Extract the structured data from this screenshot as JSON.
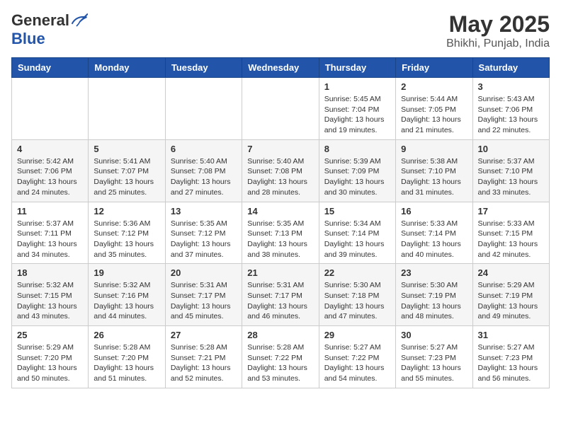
{
  "logo": {
    "general": "General",
    "blue": "Blue"
  },
  "title": "May 2025",
  "location": "Bhikhi, Punjab, India",
  "weekdays": [
    "Sunday",
    "Monday",
    "Tuesday",
    "Wednesday",
    "Thursday",
    "Friday",
    "Saturday"
  ],
  "weeks": [
    [
      {
        "day": "",
        "sunrise": "",
        "sunset": "",
        "daylight": ""
      },
      {
        "day": "",
        "sunrise": "",
        "sunset": "",
        "daylight": ""
      },
      {
        "day": "",
        "sunrise": "",
        "sunset": "",
        "daylight": ""
      },
      {
        "day": "",
        "sunrise": "",
        "sunset": "",
        "daylight": ""
      },
      {
        "day": "1",
        "sunrise": "Sunrise: 5:45 AM",
        "sunset": "Sunset: 7:04 PM",
        "daylight": "Daylight: 13 hours and 19 minutes."
      },
      {
        "day": "2",
        "sunrise": "Sunrise: 5:44 AM",
        "sunset": "Sunset: 7:05 PM",
        "daylight": "Daylight: 13 hours and 21 minutes."
      },
      {
        "day": "3",
        "sunrise": "Sunrise: 5:43 AM",
        "sunset": "Sunset: 7:06 PM",
        "daylight": "Daylight: 13 hours and 22 minutes."
      }
    ],
    [
      {
        "day": "4",
        "sunrise": "Sunrise: 5:42 AM",
        "sunset": "Sunset: 7:06 PM",
        "daylight": "Daylight: 13 hours and 24 minutes."
      },
      {
        "day": "5",
        "sunrise": "Sunrise: 5:41 AM",
        "sunset": "Sunset: 7:07 PM",
        "daylight": "Daylight: 13 hours and 25 minutes."
      },
      {
        "day": "6",
        "sunrise": "Sunrise: 5:40 AM",
        "sunset": "Sunset: 7:08 PM",
        "daylight": "Daylight: 13 hours and 27 minutes."
      },
      {
        "day": "7",
        "sunrise": "Sunrise: 5:40 AM",
        "sunset": "Sunset: 7:08 PM",
        "daylight": "Daylight: 13 hours and 28 minutes."
      },
      {
        "day": "8",
        "sunrise": "Sunrise: 5:39 AM",
        "sunset": "Sunset: 7:09 PM",
        "daylight": "Daylight: 13 hours and 30 minutes."
      },
      {
        "day": "9",
        "sunrise": "Sunrise: 5:38 AM",
        "sunset": "Sunset: 7:10 PM",
        "daylight": "Daylight: 13 hours and 31 minutes."
      },
      {
        "day": "10",
        "sunrise": "Sunrise: 5:37 AM",
        "sunset": "Sunset: 7:10 PM",
        "daylight": "Daylight: 13 hours and 33 minutes."
      }
    ],
    [
      {
        "day": "11",
        "sunrise": "Sunrise: 5:37 AM",
        "sunset": "Sunset: 7:11 PM",
        "daylight": "Daylight: 13 hours and 34 minutes."
      },
      {
        "day": "12",
        "sunrise": "Sunrise: 5:36 AM",
        "sunset": "Sunset: 7:12 PM",
        "daylight": "Daylight: 13 hours and 35 minutes."
      },
      {
        "day": "13",
        "sunrise": "Sunrise: 5:35 AM",
        "sunset": "Sunset: 7:12 PM",
        "daylight": "Daylight: 13 hours and 37 minutes."
      },
      {
        "day": "14",
        "sunrise": "Sunrise: 5:35 AM",
        "sunset": "Sunset: 7:13 PM",
        "daylight": "Daylight: 13 hours and 38 minutes."
      },
      {
        "day": "15",
        "sunrise": "Sunrise: 5:34 AM",
        "sunset": "Sunset: 7:14 PM",
        "daylight": "Daylight: 13 hours and 39 minutes."
      },
      {
        "day": "16",
        "sunrise": "Sunrise: 5:33 AM",
        "sunset": "Sunset: 7:14 PM",
        "daylight": "Daylight: 13 hours and 40 minutes."
      },
      {
        "day": "17",
        "sunrise": "Sunrise: 5:33 AM",
        "sunset": "Sunset: 7:15 PM",
        "daylight": "Daylight: 13 hours and 42 minutes."
      }
    ],
    [
      {
        "day": "18",
        "sunrise": "Sunrise: 5:32 AM",
        "sunset": "Sunset: 7:15 PM",
        "daylight": "Daylight: 13 hours and 43 minutes."
      },
      {
        "day": "19",
        "sunrise": "Sunrise: 5:32 AM",
        "sunset": "Sunset: 7:16 PM",
        "daylight": "Daylight: 13 hours and 44 minutes."
      },
      {
        "day": "20",
        "sunrise": "Sunrise: 5:31 AM",
        "sunset": "Sunset: 7:17 PM",
        "daylight": "Daylight: 13 hours and 45 minutes."
      },
      {
        "day": "21",
        "sunrise": "Sunrise: 5:31 AM",
        "sunset": "Sunset: 7:17 PM",
        "daylight": "Daylight: 13 hours and 46 minutes."
      },
      {
        "day": "22",
        "sunrise": "Sunrise: 5:30 AM",
        "sunset": "Sunset: 7:18 PM",
        "daylight": "Daylight: 13 hours and 47 minutes."
      },
      {
        "day": "23",
        "sunrise": "Sunrise: 5:30 AM",
        "sunset": "Sunset: 7:19 PM",
        "daylight": "Daylight: 13 hours and 48 minutes."
      },
      {
        "day": "24",
        "sunrise": "Sunrise: 5:29 AM",
        "sunset": "Sunset: 7:19 PM",
        "daylight": "Daylight: 13 hours and 49 minutes."
      }
    ],
    [
      {
        "day": "25",
        "sunrise": "Sunrise: 5:29 AM",
        "sunset": "Sunset: 7:20 PM",
        "daylight": "Daylight: 13 hours and 50 minutes."
      },
      {
        "day": "26",
        "sunrise": "Sunrise: 5:28 AM",
        "sunset": "Sunset: 7:20 PM",
        "daylight": "Daylight: 13 hours and 51 minutes."
      },
      {
        "day": "27",
        "sunrise": "Sunrise: 5:28 AM",
        "sunset": "Sunset: 7:21 PM",
        "daylight": "Daylight: 13 hours and 52 minutes."
      },
      {
        "day": "28",
        "sunrise": "Sunrise: 5:28 AM",
        "sunset": "Sunset: 7:22 PM",
        "daylight": "Daylight: 13 hours and 53 minutes."
      },
      {
        "day": "29",
        "sunrise": "Sunrise: 5:27 AM",
        "sunset": "Sunset: 7:22 PM",
        "daylight": "Daylight: 13 hours and 54 minutes."
      },
      {
        "day": "30",
        "sunrise": "Sunrise: 5:27 AM",
        "sunset": "Sunset: 7:23 PM",
        "daylight": "Daylight: 13 hours and 55 minutes."
      },
      {
        "day": "31",
        "sunrise": "Sunrise: 5:27 AM",
        "sunset": "Sunset: 7:23 PM",
        "daylight": "Daylight: 13 hours and 56 minutes."
      }
    ]
  ]
}
